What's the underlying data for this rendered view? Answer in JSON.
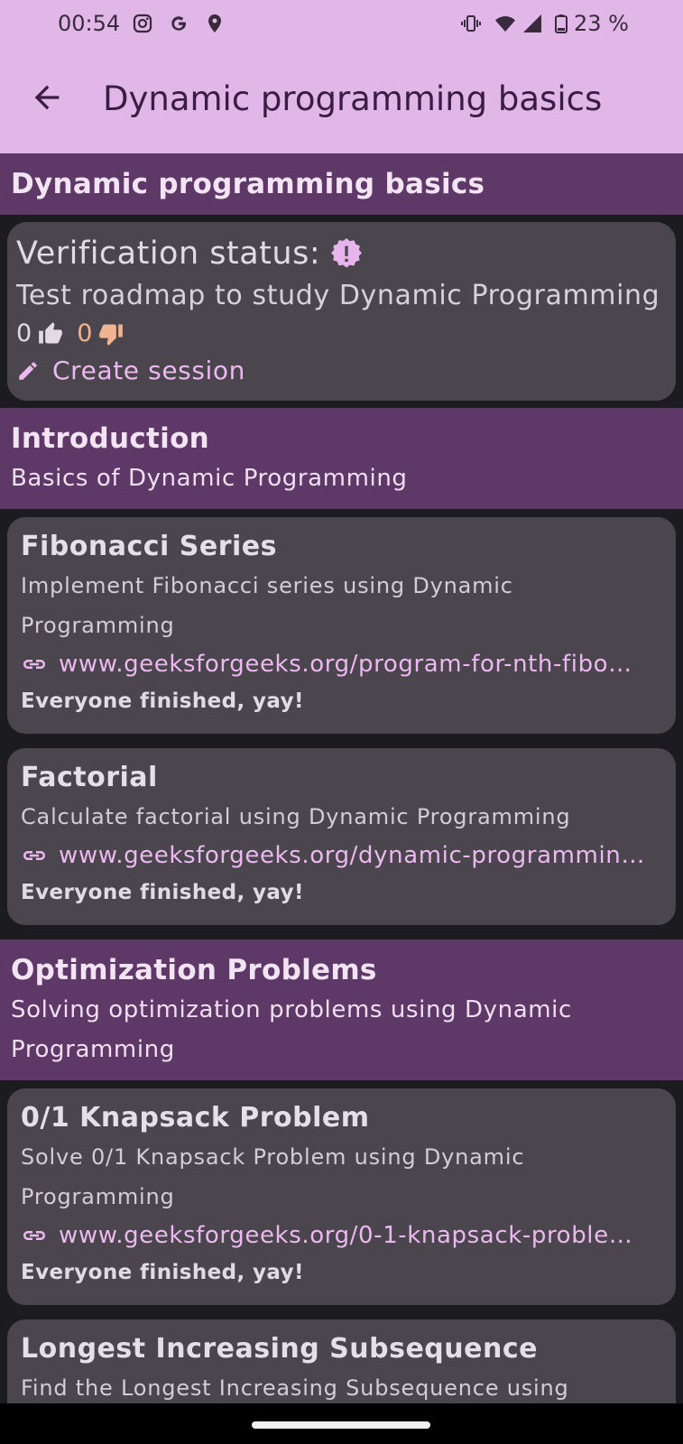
{
  "status_bar": {
    "time": "00:54",
    "battery_text": "23 %",
    "left_icons": [
      "instagram-icon",
      "google-icon",
      "location-pin-icon"
    ],
    "right_icons": [
      "vibrate-icon",
      "wifi-icon",
      "cell-signal-icon",
      "battery-icon"
    ]
  },
  "app_bar": {
    "title": "Dynamic programming basics",
    "back_icon": "arrow-back-icon"
  },
  "roadmap": {
    "title": "Dynamic programming basics",
    "verification_label": "Verification status:",
    "description": "Test roadmap to study Dynamic Programming",
    "upvotes": "0",
    "downvotes": "0",
    "create_session_label": "Create session"
  },
  "sections": [
    {
      "title": "Introduction",
      "subtitle": "Basics of Dynamic Programming",
      "tasks": [
        {
          "title": "Fibonacci Series",
          "description": "Implement Fibonacci series using Dynamic Programming",
          "link": "www.geeksforgeeks.org/program-for-nth-fibo…",
          "status": "Everyone finished, yay!"
        },
        {
          "title": "Factorial",
          "description": "Calculate factorial using Dynamic Programming",
          "link": "www.geeksforgeeks.org/dynamic-programmin…",
          "status": "Everyone finished, yay!"
        }
      ]
    },
    {
      "title": "Optimization Problems",
      "subtitle": "Solving optimization problems using Dynamic Programming",
      "tasks": [
        {
          "title": "0/1 Knapsack Problem",
          "description": "Solve 0/1 Knapsack Problem using Dynamic Programming",
          "link": "www.geeksforgeeks.org/0-1-knapsack-proble…",
          "status": "Everyone finished, yay!"
        },
        {
          "title": "Longest Increasing Subsequence",
          "description": "Find the Longest Increasing Subsequence using Dynamic Programming",
          "link": "",
          "status": ""
        }
      ]
    }
  ],
  "colors": {
    "app_bar_bg": "#e0b7e7",
    "section_bg": "#5e3866",
    "card_bg": "#4b454d",
    "page_bg": "#1c1b1f",
    "accent": "#ecb8f0",
    "downvote": "#f2b38f"
  }
}
